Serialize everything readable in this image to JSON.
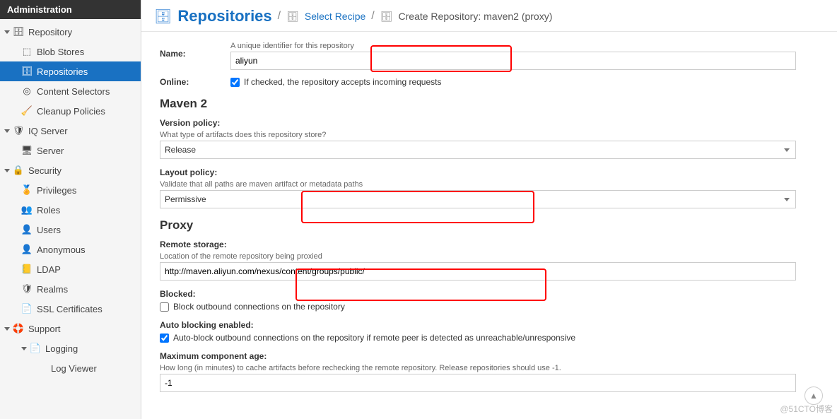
{
  "sidebar": {
    "title": "Administration",
    "items": [
      {
        "label": "Repository",
        "icon": "🗄",
        "level": 1,
        "caret": true
      },
      {
        "label": "Blob Stores",
        "icon": "⬚",
        "level": 2
      },
      {
        "label": "Repositories",
        "icon": "🗄",
        "level": 2,
        "active": true
      },
      {
        "label": "Content Selectors",
        "icon": "◎",
        "level": 2
      },
      {
        "label": "Cleanup Policies",
        "icon": "🧹",
        "level": 2
      },
      {
        "label": "IQ Server",
        "icon": "🛡",
        "level": 1,
        "caret": true
      },
      {
        "label": "Server",
        "icon": "🖥",
        "level": 2
      },
      {
        "label": "Security",
        "icon": "🔒",
        "level": 1,
        "caret": true
      },
      {
        "label": "Privileges",
        "icon": "🏅",
        "level": 2
      },
      {
        "label": "Roles",
        "icon": "👥",
        "level": 2
      },
      {
        "label": "Users",
        "icon": "👤",
        "level": 2
      },
      {
        "label": "Anonymous",
        "icon": "👤",
        "level": 2
      },
      {
        "label": "LDAP",
        "icon": "📒",
        "level": 2
      },
      {
        "label": "Realms",
        "icon": "🛡",
        "level": 2
      },
      {
        "label": "SSL Certificates",
        "icon": "📄",
        "level": 2
      },
      {
        "label": "Support",
        "icon": "🛟",
        "level": 1,
        "caret": true
      },
      {
        "label": "Logging",
        "icon": "📄",
        "level": 2,
        "caret": true
      },
      {
        "label": "Log Viewer",
        "icon": "",
        "level": 3
      }
    ]
  },
  "breadcrumb": {
    "title": "Repositories",
    "select_recipe": "Select Recipe",
    "current": "Create Repository: maven2 (proxy)"
  },
  "form": {
    "name": {
      "label": "Name:",
      "help": "A unique identifier for this repository",
      "value": "aliyun"
    },
    "online": {
      "label": "Online:",
      "text": "If checked, the repository accepts incoming requests",
      "checked": true
    },
    "maven2_heading": "Maven 2",
    "version_policy": {
      "label": "Version policy:",
      "help": "What type of artifacts does this repository store?",
      "value": "Release"
    },
    "layout_policy": {
      "label": "Layout policy:",
      "help": "Validate that all paths are maven artifact or metadata paths",
      "value": "Permissive"
    },
    "proxy_heading": "Proxy",
    "remote_storage": {
      "label": "Remote storage:",
      "help": "Location of the remote repository being proxied",
      "value": "http://maven.aliyun.com/nexus/content/groups/public/"
    },
    "blocked": {
      "label": "Blocked:",
      "text": "Block outbound connections on the repository",
      "checked": false
    },
    "auto_blocking": {
      "label": "Auto blocking enabled:",
      "text": "Auto-block outbound connections on the repository if remote peer is detected as unreachable/unresponsive",
      "checked": true
    },
    "max_age": {
      "label": "Maximum component age:",
      "help": "How long (in minutes) to cache artifacts before rechecking the remote repository. Release repositories should use -1.",
      "value": "-1"
    }
  },
  "watermark": "@51CTO博客"
}
